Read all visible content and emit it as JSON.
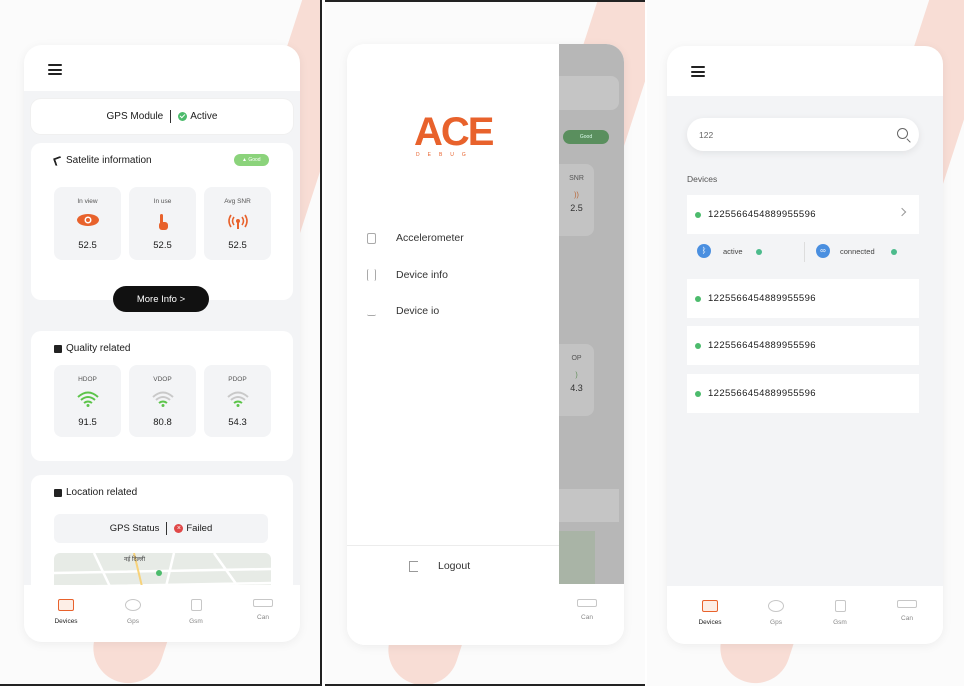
{
  "screen1": {
    "gps_module_label": "GPS Module",
    "gps_module_status": "Active",
    "satellite": {
      "title": "Satelite information",
      "badge": "Good",
      "items": [
        {
          "label": "In view",
          "value": "52.5"
        },
        {
          "label": "In use",
          "value": "52.5"
        },
        {
          "label": "Avg SNR",
          "value": "52.5"
        }
      ],
      "more_info": "More Info >"
    },
    "quality": {
      "title": "Quality related",
      "items": [
        {
          "label": "HDOP",
          "value": "91.5"
        },
        {
          "label": "VDOP",
          "value": "80.8"
        },
        {
          "label": "PDOP",
          "value": "54.3"
        }
      ]
    },
    "location": {
      "title": "Location related",
      "gps_status_label": "GPS Status",
      "gps_status_value": "Failed",
      "map_label": "नई दिल्ली"
    }
  },
  "drawer": {
    "logo_word": "ACE",
    "logo_sub": "DEBUG",
    "menu": [
      {
        "label": "Accelerometer",
        "icon": "device-icon"
      },
      {
        "label": "Device info",
        "icon": "antenna-icon"
      },
      {
        "label": "Device io",
        "icon": "download-icon"
      }
    ],
    "logout": "Logout",
    "bg_badge": "Good",
    "bg_snr": "SNR",
    "bg_val": "2.5",
    "bg_op": "OP",
    "bg_val2": "4.3"
  },
  "screen3": {
    "search_value": "122",
    "devices_heading": "Devices",
    "devices": [
      "1225566454889955596",
      "1225566454889955596",
      "1225566454889955596",
      "1225566454889955596"
    ],
    "status_active": "active",
    "status_connected": "connected"
  },
  "tabbar": [
    {
      "label": "Devices",
      "icon": "devices-icon"
    },
    {
      "label": "Gps",
      "icon": "gps-icon"
    },
    {
      "label": "Gsm",
      "icon": "gsm-icon"
    },
    {
      "label": "Can",
      "icon": "can-icon"
    }
  ],
  "colors": {
    "accent": "#e8622c",
    "good": "#8bd37b",
    "status_green": "#4cbb6c",
    "failed": "#e04848"
  }
}
